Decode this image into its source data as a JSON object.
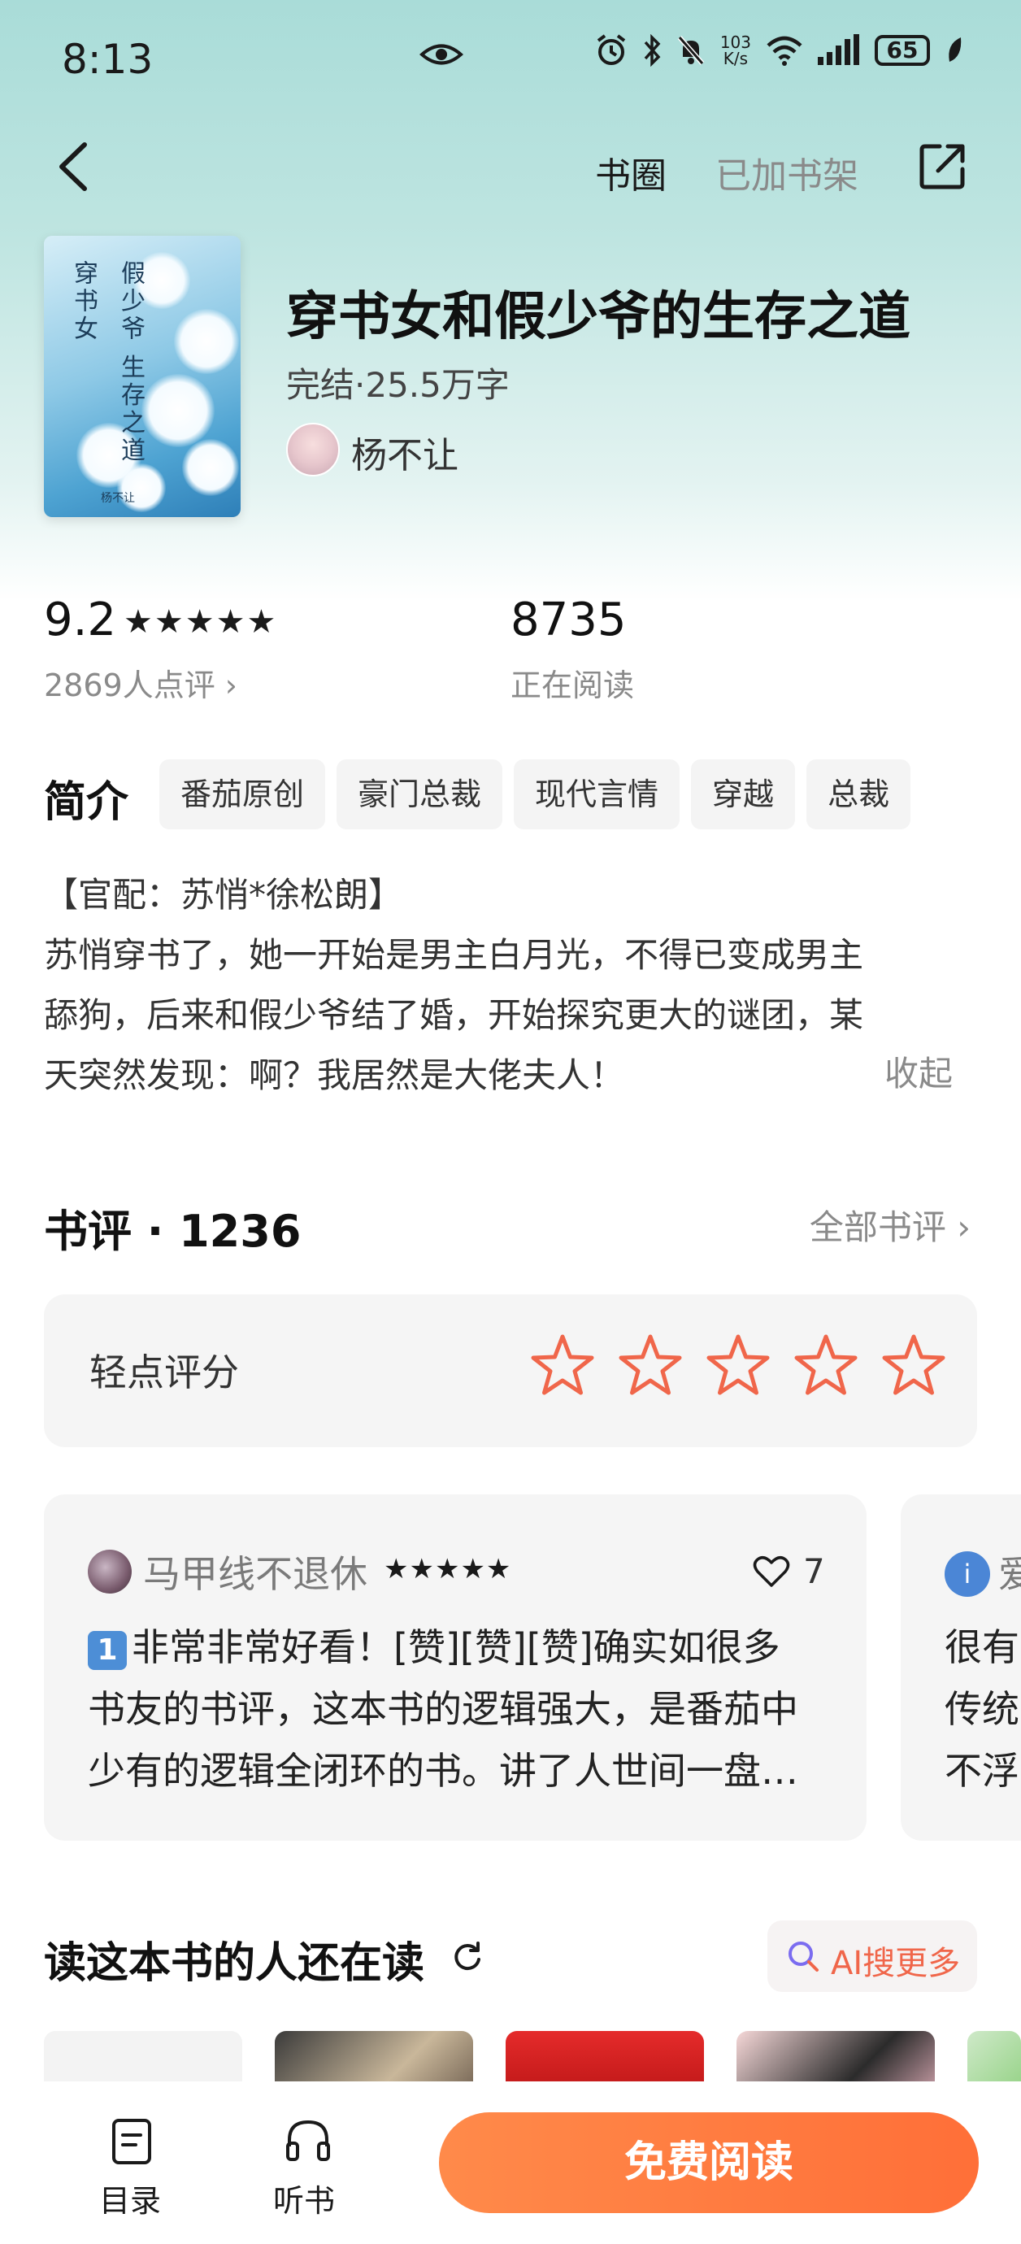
{
  "status": {
    "time": "8:13",
    "net_speed_value": "103",
    "net_speed_unit": "K/s",
    "battery": "65"
  },
  "nav": {
    "ring": "书圈",
    "shelf": "已加书架"
  },
  "book": {
    "title": "穿书女和假少爷的生存之道",
    "meta": "完结·25.5万字",
    "author": "杨不让",
    "cover_text_1": "穿书女",
    "cover_text_2": "假少爷 生存之道",
    "cover_author": "杨不让"
  },
  "stats": {
    "score": "9.2",
    "score_stars": "★★★★★",
    "rating_count": "2869人点评 ›",
    "readers": "8735",
    "readers_label": "正在阅读"
  },
  "intro": {
    "heading": "简介",
    "tags": [
      "番茄原创",
      "豪门总裁",
      "现代言情",
      "穿越",
      "总裁"
    ],
    "lines": [
      "【官配：苏悄*徐松朗】",
      "苏悄穿书了，她一开始是男主白月光，不得已变成男主",
      "舔狗，后来和假少爷结了婚，开始探究更大的谜团，某",
      "天突然发现：啊？我居然是大佬夫人！"
    ],
    "collapse": "收起"
  },
  "reviews": {
    "heading": "书评 · 1236",
    "all_link": "全部书评 ›",
    "rate_label": "轻点评分",
    "rate_star_count": 5,
    "accent": "#f0664a",
    "cards": [
      {
        "user": "马甲线不退休",
        "stars": "★★★★★",
        "likes": "7",
        "badge": "1",
        "lines": [
          "非常非常好看！[赞][赞][赞]确实如很多",
          "书友的书评，这本书的逻辑强大，是番茄中",
          "少有的逻辑全闭环的书。讲了人世间一盘…"
        ]
      },
      {
        "user": "爱",
        "lines": [
          "很有",
          "传统",
          "不浮"
        ]
      }
    ]
  },
  "also": {
    "heading": "读这本书的人还在读",
    "ai_button": "AI搜更多"
  },
  "bottom": {
    "toc": "目录",
    "listen": "听书",
    "read": "免费阅读"
  }
}
